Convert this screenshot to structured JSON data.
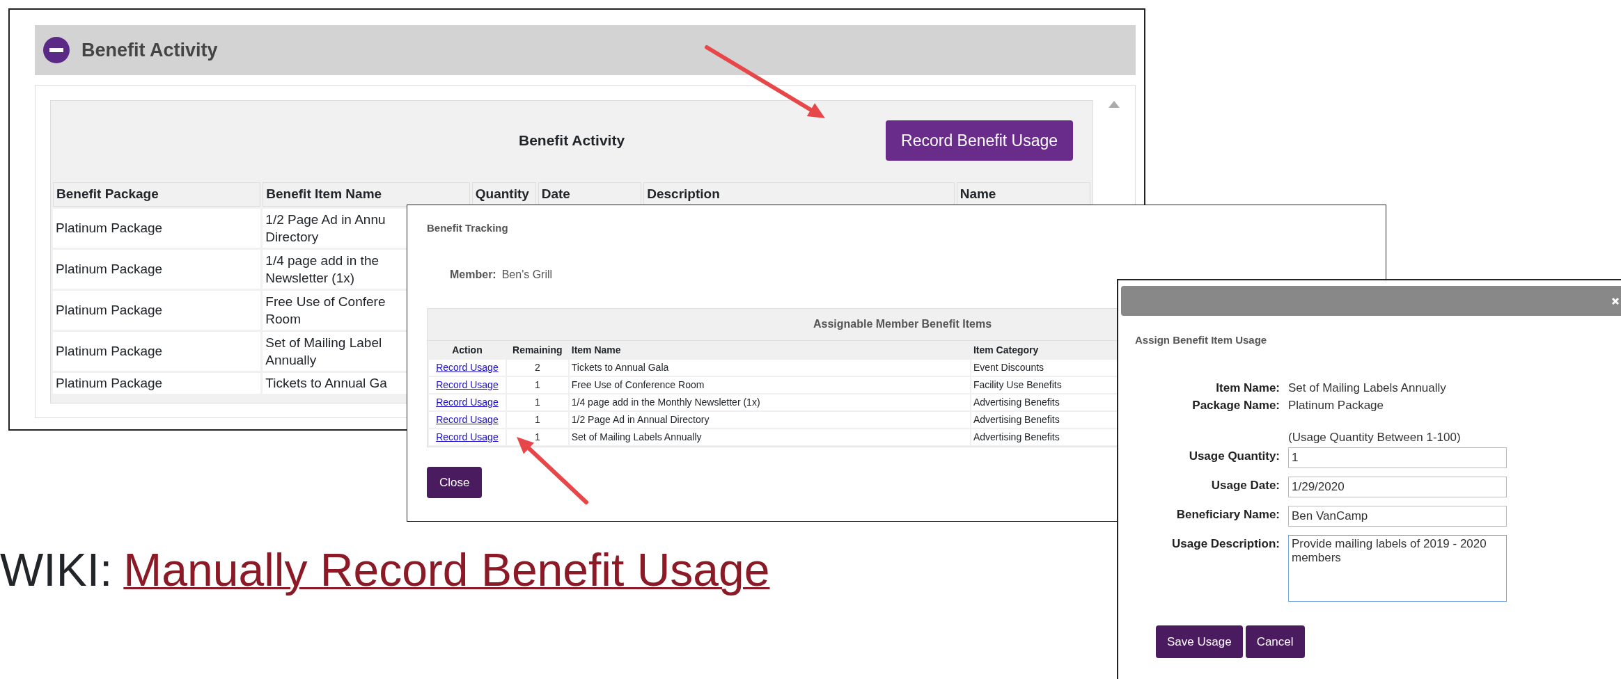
{
  "activity_panel": {
    "title": "Benefit Activity",
    "expanded": true,
    "section_title": "Benefit Activity",
    "record_button": "Record Benefit Usage",
    "table": {
      "columns": [
        "Benefit Package",
        "Benefit Item Name",
        "Quantity",
        "Date",
        "Description",
        "Name"
      ],
      "rows": [
        {
          "package": "Platinum Package",
          "item_name": "1/2 Page Ad in Annu\nDirectory"
        },
        {
          "package": "Platinum Package",
          "item_name": "1/4 page add in the\nNewsletter (1x)"
        },
        {
          "package": "Platinum Package",
          "item_name": "Free Use of Confere\nRoom"
        },
        {
          "package": "Platinum Package",
          "item_name": "Set of Mailing Label\nAnnually"
        },
        {
          "package": "Platinum Package",
          "item_name": "Tickets to Annual Ga"
        }
      ]
    }
  },
  "tracking_dialog": {
    "title": "Benefit Tracking",
    "member_label": "Member:",
    "member_value": "Ben's Grill",
    "table": {
      "title": "Assignable Member Benefit Items",
      "columns": [
        "Action",
        "Remaining",
        "Item Name",
        "Item Category"
      ],
      "rows": [
        {
          "action": "Record Usage",
          "remaining": "2",
          "item_name": "Tickets to Annual Gala",
          "category": "Event Discounts"
        },
        {
          "action": "Record Usage",
          "remaining": "1",
          "item_name": "Free Use of Conference Room",
          "category": "Facility Use Benefits"
        },
        {
          "action": "Record Usage",
          "remaining": "1",
          "item_name": "1/4 page add in the Monthly Newsletter (1x)",
          "category": "Advertising Benefits"
        },
        {
          "action": "Record Usage",
          "remaining": "1",
          "item_name": "1/2 Page Ad in Annual Directory",
          "category": "Advertising Benefits"
        },
        {
          "action": "Record Usage",
          "remaining": "1",
          "item_name": "Set of Mailing Labels Annually",
          "category": "Advertising Benefits"
        }
      ]
    },
    "close_button": "Close"
  },
  "usage_dialog": {
    "title": "Assign Benefit Item Usage",
    "details": [
      {
        "label": "Item Name:",
        "value": "Set of Mailing Labels Annually"
      },
      {
        "label": "Package Name:",
        "value": "Platinum Package"
      }
    ],
    "hint": "(Usage Quantity Between 1-100)",
    "fields": [
      {
        "label": "Usage Quantity:",
        "value": "1",
        "kind": "input",
        "focused": false
      },
      {
        "label": "Usage Date:",
        "value": "1/29/2020",
        "kind": "input",
        "focused": false
      },
      {
        "label": "Beneficiary Name:",
        "value": "Ben VanCamp",
        "kind": "input",
        "focused": false
      },
      {
        "label": "Usage Description:",
        "value": "Provide mailing labels of 2019 - 2020 members",
        "kind": "textarea",
        "focused": true
      }
    ],
    "buttons": [
      "Save Usage",
      "Cancel"
    ]
  },
  "wiki": {
    "prefix": "WIKI:",
    "link": "Manually Record Benefit Usage"
  }
}
